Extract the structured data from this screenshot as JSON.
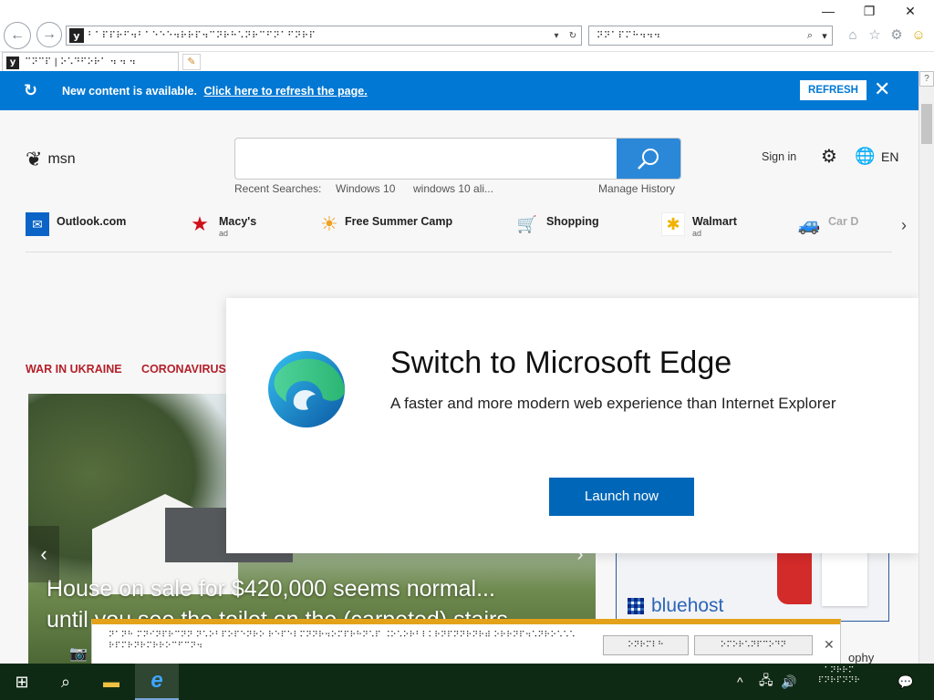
{
  "browser": {
    "address": "⠃⠁⠏⠏⠗⠋⠲⠃⠁⠑⠑⠑⠲⠗⠗⠏⠲⠉⠝⠗⠓⠡⠝⠗⠉⠋⠝⠁⠋⠝⠗⠏",
    "search_text": "⠝⠝⠁⠏⠍⠓⠲⠲⠲",
    "tab_label": "⠉⠝⠉⠏ | ⠕⠡⠙⠋⠕⠗⠁ ⠲ ⠲ ⠲",
    "back_label": "←",
    "forward_label": "→",
    "refresh_label": "↻",
    "dropdown_label": "▾",
    "search_icon": "⌕",
    "minimize": "—",
    "restore": "❐",
    "close": "✕",
    "home": "⌂",
    "favorites": "☆",
    "tools": "⚙",
    "feedback": "☺",
    "new_tab": "✎"
  },
  "banner": {
    "message": "New content is available.",
    "link": "Click here to refresh the page.",
    "button": "REFRESH",
    "close": "✕",
    "icon": "↻",
    "color": "#0078d4"
  },
  "header": {
    "logo_text": "msn",
    "logo_icon": "❦",
    "recent_label": "Recent Searches:",
    "recent_1": "Windows 10",
    "recent_2": "windows 10 ali...",
    "manage_history": "Manage History",
    "signin": "Sign in",
    "settings_icon": "⚙",
    "globe_icon": "🌐",
    "language": "EN"
  },
  "quicklinks": [
    {
      "label": "Outlook.com",
      "sub": "",
      "icon": "✉",
      "color": "#0a64c8"
    },
    {
      "label": "Macy's",
      "sub": "ad",
      "icon": "★",
      "color": "#d0101a"
    },
    {
      "label": "Free Summer Camp",
      "sub": "",
      "icon": "☀",
      "color": "#f0a020"
    },
    {
      "label": "Shopping",
      "sub": "",
      "icon": "🛒",
      "color": "#1068c8"
    },
    {
      "label": "Walmart",
      "sub": "ad",
      "icon": "✱",
      "color": "#f2b200"
    },
    {
      "label": "Car D",
      "sub": "",
      "icon": "🚙",
      "color": "#3a7fc0"
    }
  ],
  "quicklinks_next": "›",
  "categories": [
    "WAR IN UKRAINE",
    "CORONAVIRUS"
  ],
  "hero": {
    "title_line1": "House on sale for $420,000 seems normal...",
    "title_line2": "until you see the toilet on the (carpeted) stairs",
    "prev": "‹",
    "next": "›",
    "camera_icon": "📷"
  },
  "ad": {
    "brand": "bluehost",
    "partial": "ophy"
  },
  "modal": {
    "title": "Switch to Microsoft Edge",
    "subtitle": "A faster and more modern web experience than Internet Explorer",
    "button": "Launch now"
  },
  "notification": {
    "message": "⠝⠁⠝⠓ ⠍⠝⠊⠝⠏⠗⠉⠝⠝ ⠝⠡⠕⠃⠏⠕⠏⠑⠝⠗⠕ ⠗⠑⠏⠑⠇⠍⠝⠝⠗⠲⠕⠍⠏⠗⠓⠝⠡⠏ ⠨⠕⠡⠕⠗⠃⠇⠅⠗⠝⠏⠝⠝⠗⠝⠗⠾ ⠕⠗⠗⠝⠏⠲⠡⠝⠗⠕⠡⠡⠡ ⠗⠏⠍⠗⠝⠗⠍⠗⠗⠕⠉⠋⠉⠝⠲",
    "button1": "⠕⠝⠗⠍⠇⠓",
    "button2": "⠕⠍⠕⠗⠡⠝⠏⠉⠕⠙⠝",
    "close": "✕"
  },
  "taskbar": {
    "start_icon": "⊞",
    "search_icon": "⌕",
    "explorer_icon": "▬",
    "ie_icon": "e",
    "tray_up": "^",
    "network": "🖧",
    "volume": "🔊",
    "clock_line1": "⠁⠝⠗⠗⠍",
    "clock_line2": "⠏⠝⠗⠏⠝⠝⠗",
    "notifications_icon": "💬"
  }
}
